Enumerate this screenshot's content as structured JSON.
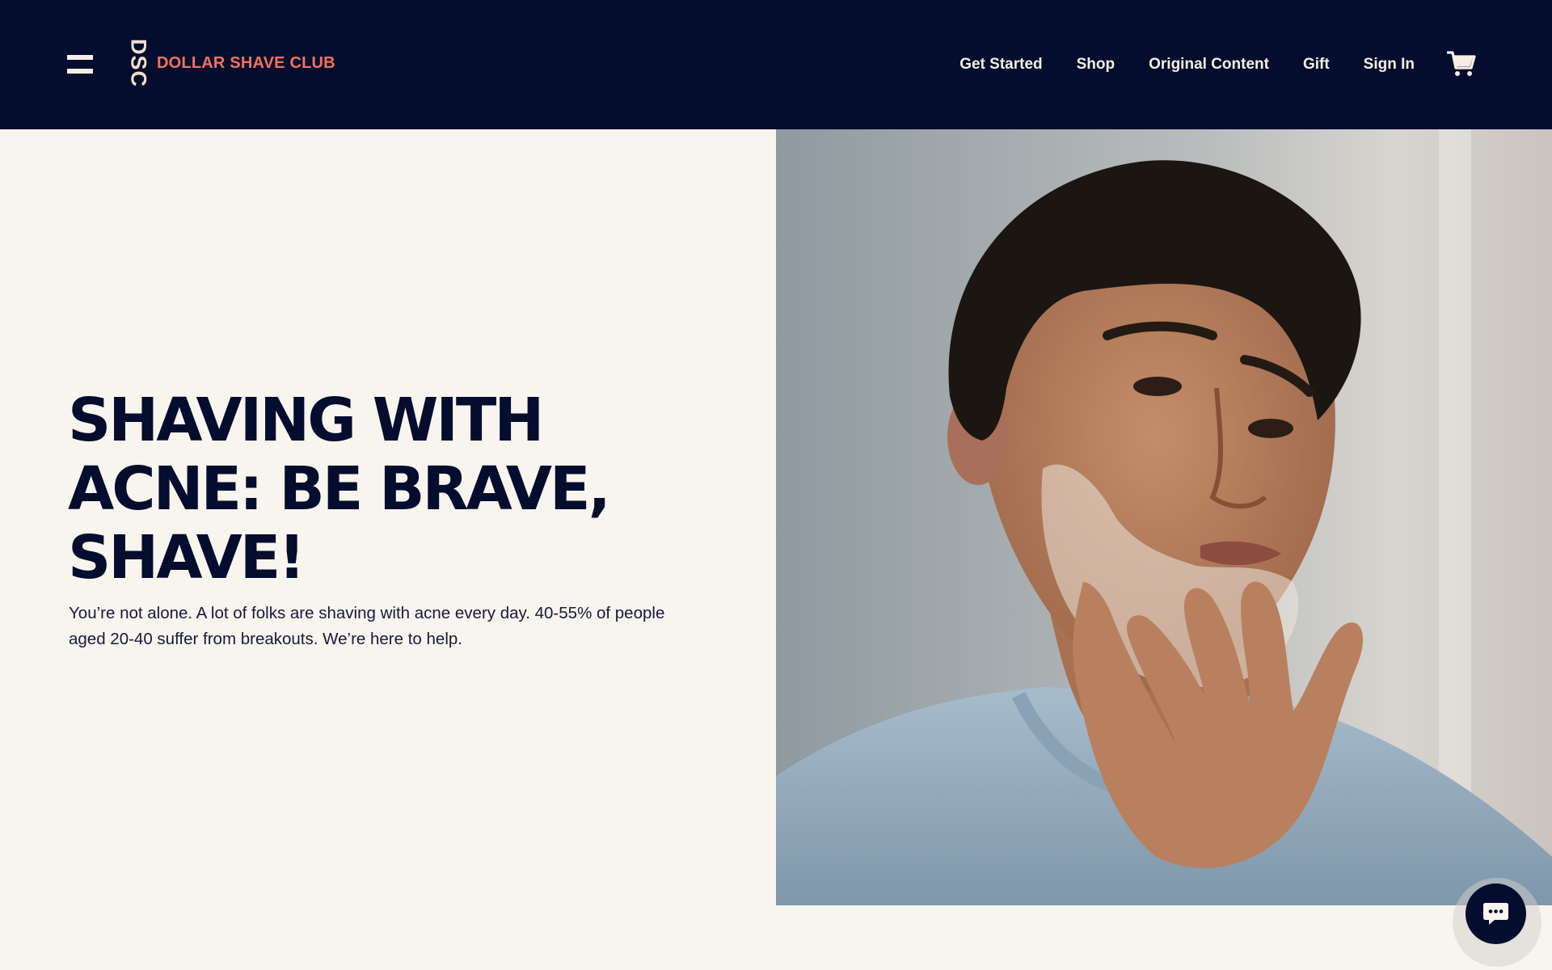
{
  "header": {
    "menu_icon": "hamburger-menu-icon",
    "logo_mark": "DSC",
    "brand_name": "DOLLAR SHAVE CLUB",
    "nav": [
      {
        "label": "Get Started"
      },
      {
        "label": "Shop"
      },
      {
        "label": "Original Content"
      },
      {
        "label": "Gift"
      },
      {
        "label": "Sign In"
      }
    ],
    "cart_icon": "shopping-cart-icon"
  },
  "hero": {
    "title": "SHAVING WITH ACNE: BE BRAVE, SHAVE!",
    "body": "You’re not alone. A lot of folks are shaving with acne every day. 40-55% of people aged 20-40 suffer from breakouts. We’re here to help.",
    "image_alt_subject": "Man applying shaving cream to his face"
  },
  "chat": {
    "icon": "chat-bubble-icon"
  },
  "colors": {
    "navy": "#040d2e",
    "cream": "#f8f4ee",
    "logo_mark": "#f0dfc8",
    "brand_coral": "#f0735c",
    "nav_text": "#f6eee3"
  }
}
